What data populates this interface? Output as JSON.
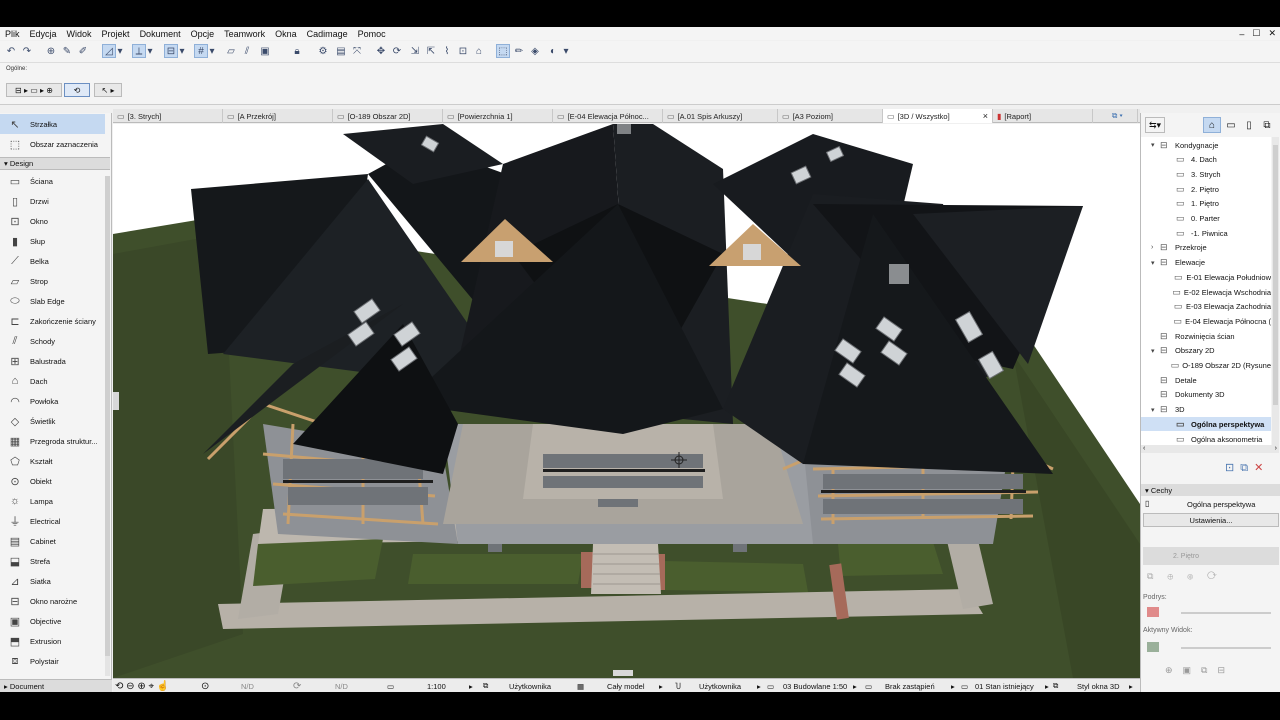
{
  "menu": [
    "Plik",
    "Edycja",
    "Widok",
    "Projekt",
    "Dokument",
    "Opcje",
    "Teamwork",
    "Okna",
    "Cadimage",
    "Pomoc"
  ],
  "window_controls": {
    "minimize": "–",
    "maximize": "☐",
    "close": "✕"
  },
  "infobox": {
    "label": "Ogólne:"
  },
  "toolbox": {
    "top_items": [
      "Strzałka",
      "Obszar zaznaczenia"
    ],
    "design_header": "Design",
    "items": [
      "Ściana",
      "Drzwi",
      "Okno",
      "Słup",
      "Belka",
      "Strop",
      "Slab Edge",
      "Zakończenie ściany",
      "Schody",
      "Balustrada",
      "Dach",
      "Powłoka",
      "Świetlik",
      "Przegroda struktur...",
      "Kształt",
      "Obiekt",
      "Lampa",
      "Electrical",
      "Cabinet",
      "Strefa",
      "Siatka",
      "Okno narożne",
      "Objective",
      "Extrusion",
      "Polystair"
    ],
    "document_header": "Document"
  },
  "tabs": [
    {
      "label": "[3. Strych]",
      "icon": "floorplan-icon"
    },
    {
      "label": "[A Przekrój]",
      "icon": "section-icon"
    },
    {
      "label": "[O-189 Obszar 2D]",
      "icon": "worksheet-icon"
    },
    {
      "label": "[Powierzchnia 1]",
      "icon": "schedule-icon"
    },
    {
      "label": "[E-04 Elewacja Północ...",
      "icon": "elevation-icon"
    },
    {
      "label": "[A.01 Spis Arkuszy]",
      "icon": "layout-icon"
    },
    {
      "label": "[A3 Poziom]",
      "icon": "layout-icon"
    },
    {
      "label": "[3D / Wszystko]",
      "icon": "3d-icon",
      "active": true,
      "close": "×"
    },
    {
      "label": "[Raport]",
      "icon": "report-icon"
    }
  ],
  "navigator": {
    "rows": [
      {
        "label": "Kondygnacje",
        "level": 0,
        "twisty": "▾"
      },
      {
        "label": "4. Dach",
        "level": 1
      },
      {
        "label": "3. Strych",
        "level": 1
      },
      {
        "label": "2. Piętro",
        "level": 1
      },
      {
        "label": "1. Piętro",
        "level": 1
      },
      {
        "label": "0. Parter",
        "level": 1
      },
      {
        "label": "-1. Piwnica",
        "level": 1
      },
      {
        "label": "Przekroje",
        "level": 0,
        "twisty": "›"
      },
      {
        "label": "Elewacje",
        "level": 0,
        "twisty": "▾"
      },
      {
        "label": "E-01 Elewacja Południow",
        "level": 1
      },
      {
        "label": "E-02 Elewacja Wschodnia",
        "level": 1
      },
      {
        "label": "E-03 Elewacja Zachodnia",
        "level": 1
      },
      {
        "label": "E-04 Elewacja Północna (",
        "level": 1
      },
      {
        "label": "Rozwinięcia ścian",
        "level": 0
      },
      {
        "label": "Obszary 2D",
        "level": 0,
        "twisty": "▾"
      },
      {
        "label": "O-189 Obszar 2D (Rysune",
        "level": 1
      },
      {
        "label": "Detale",
        "level": 0
      },
      {
        "label": "Dokumenty 3D",
        "level": 0
      },
      {
        "label": "3D",
        "level": 0,
        "twisty": "▾"
      },
      {
        "label": "Ogólna perspektywa",
        "level": 1,
        "selected": true
      },
      {
        "label": "Ogólna aksonometria",
        "level": 1
      }
    ]
  },
  "properties": {
    "header": "Cechy",
    "view_name": "Ogólna perspektywa",
    "settings_button": "Ustawienia...",
    "story_dropdown": "2. Piętro",
    "podrys_label": "Podrys:",
    "active_view_label": "Aktywny Widok:"
  },
  "statusbar": {
    "nd1": "N/D",
    "nd2": "N/D",
    "scale": "1:100",
    "layer_combo": "Użytkownika",
    "model_view": "Cały model",
    "pen_set": "Użytkownika",
    "mvo": "03 Budowlane 1:50",
    "override": "Brak zastąpień",
    "renovation": "01 Stan istniejący",
    "style3d": "Styl okna 3D"
  },
  "colors": {
    "accent": "#c5d9f1",
    "roof": "#15181b",
    "grass": "#3a4a26",
    "paving": "#b9b3ac",
    "wood": "#c8a070",
    "walls": "#8f9297"
  }
}
